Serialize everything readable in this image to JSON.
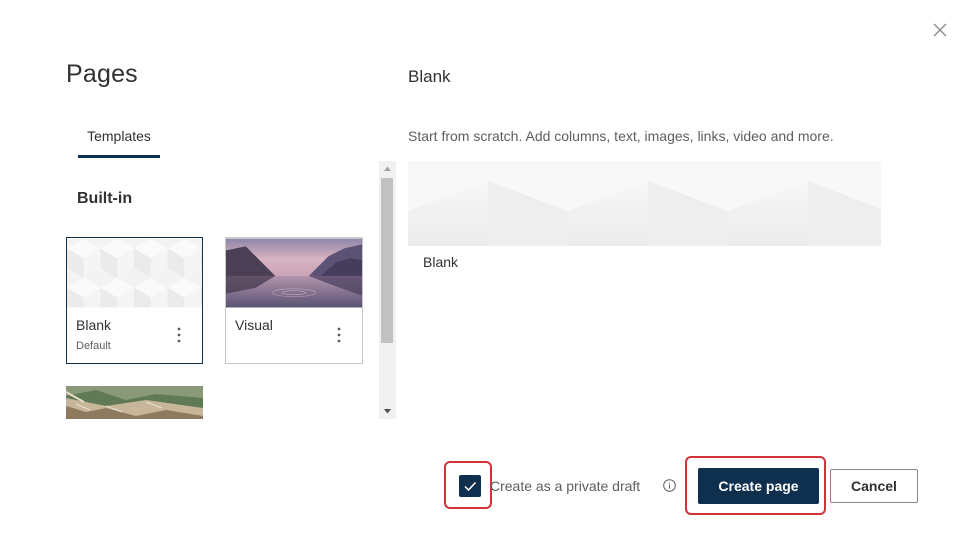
{
  "dialog": {
    "title": "Pages",
    "close_icon": "close-icon"
  },
  "tabs": [
    {
      "label": "Templates",
      "selected": true
    }
  ],
  "section": {
    "heading": "Built-in"
  },
  "templates": [
    {
      "title": "Blank",
      "subtitle": "Default",
      "selected": true,
      "more_icon": "more-vertical-icon"
    },
    {
      "title": "Visual",
      "subtitle": "",
      "selected": false,
      "more_icon": "more-vertical-icon"
    },
    {
      "title": "",
      "subtitle": "",
      "selected": false
    }
  ],
  "preview": {
    "title": "Blank",
    "description": "Start from scratch. Add columns, text, images, links, video and more.",
    "label": "Blank"
  },
  "footer": {
    "private_draft_checked": true,
    "private_draft_label": "Create as a private draft",
    "info_icon": "info-icon",
    "create_label": "Create page",
    "cancel_label": "Cancel"
  },
  "colors": {
    "accent": "#0f2f4f",
    "highlight": "#d13438"
  }
}
